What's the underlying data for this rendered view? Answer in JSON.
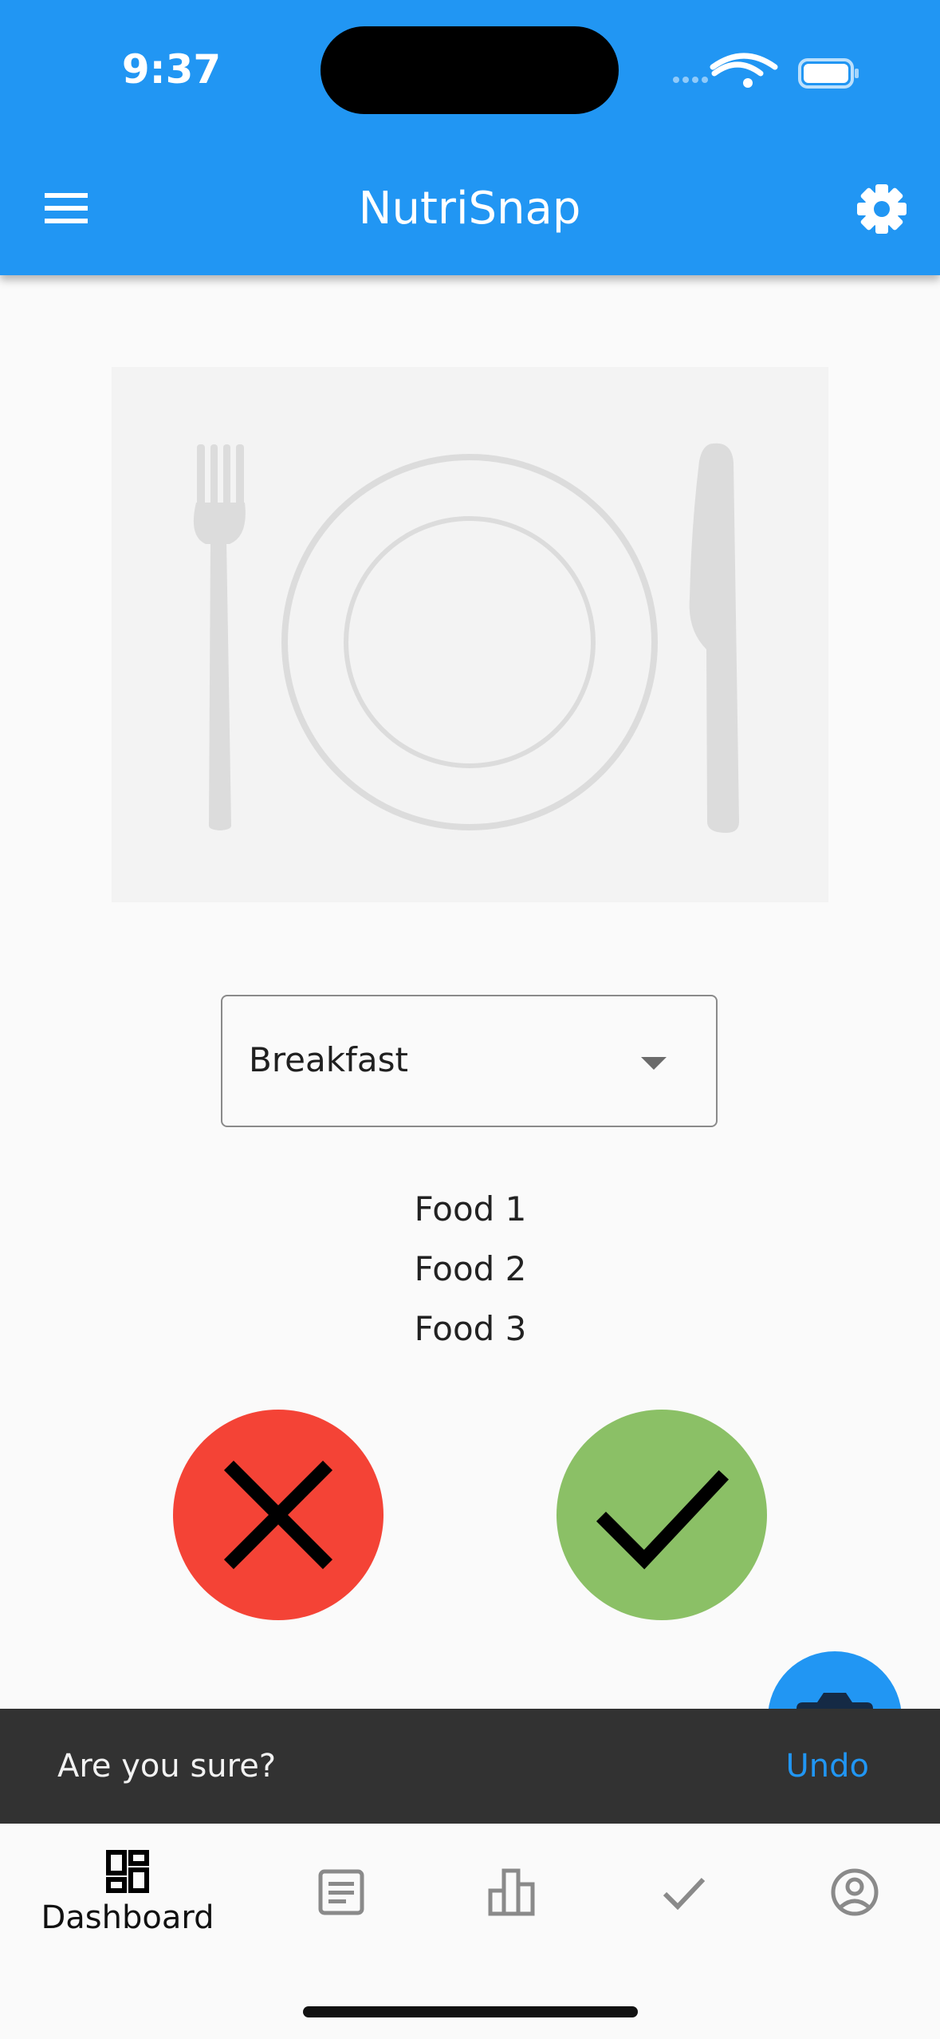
{
  "status_bar": {
    "time": "9:37"
  },
  "app_bar": {
    "title": "NutriSnap",
    "color": "#2196f3",
    "icons": [
      "menu-icon",
      "settings-gear-icon"
    ]
  },
  "meal_image": {
    "icon": "plate-fork-knife-icon"
  },
  "meal_selector": {
    "selected": "Breakfast"
  },
  "foods": [
    "Food 1",
    "Food 2",
    "Food 3"
  ],
  "actions": {
    "reject_color": "#f44336",
    "accept_color": "#8bc066",
    "reject_icon": "close-x-icon",
    "accept_icon": "checkmark-icon"
  },
  "fab": {
    "icon": "camera-icon",
    "color": "#2196f3"
  },
  "snackbar": {
    "message": "Are you sure?",
    "action": "Undo",
    "action_color": "#2196f3"
  },
  "bottom_nav": {
    "items": [
      {
        "label": "Dashboard",
        "icon": "dashboard-icon",
        "active": true
      },
      {
        "icon": "list-article-icon",
        "active": false
      },
      {
        "icon": "bar-chart-icon",
        "active": false
      },
      {
        "icon": "check-icon",
        "active": false
      },
      {
        "icon": "account-circle-icon",
        "active": false
      }
    ]
  }
}
